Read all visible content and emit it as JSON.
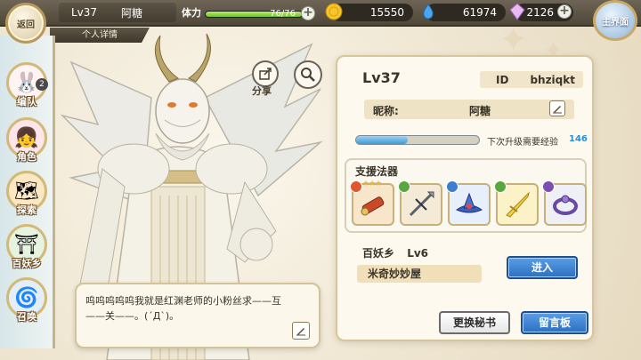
{
  "topbar": {
    "back_label": "返回",
    "player_level": "Lv37",
    "player_name": "阿糖",
    "stamina_label": "体力",
    "stamina_value": "76/76",
    "stamina_fraction": 1.0,
    "gold": "15550",
    "water": "61974",
    "crystal": "2126",
    "main_label": "主界面"
  },
  "tab": {
    "label": "个人详情"
  },
  "nav": {
    "items": [
      {
        "label": "编队",
        "icon": "team-icon",
        "badge": "2"
      },
      {
        "label": "角色",
        "icon": "character-icon",
        "badge": ""
      },
      {
        "label": "探索",
        "icon": "explore-icon",
        "badge": ""
      },
      {
        "label": "百妖乡",
        "icon": "village-icon",
        "badge": ""
      },
      {
        "label": "召唤",
        "icon": "summon-icon",
        "badge": ""
      }
    ]
  },
  "share_label": "分享",
  "dialog": {
    "text": "呜呜呜呜呜我就是红渊老师的小粉丝求——互——关——。(´Д`)。"
  },
  "profile": {
    "level": "Lv37",
    "id_label": "ID",
    "id_value": "bhziqkt",
    "nickname_label": "昵称:",
    "nickname_value": "阿糖",
    "exp_label": "下次升级需要经验",
    "exp_value": "146",
    "exp_fraction": 0.42,
    "support_title": "支援法器",
    "fabao": [
      {
        "name": "red-scroll-item",
        "element": "fire",
        "color": "#e0562e",
        "stars": 3
      },
      {
        "name": "spear-item",
        "element": "wind",
        "color": "#5aa640",
        "stars": 0
      },
      {
        "name": "blue-hat-item",
        "element": "water",
        "color": "#3b7fd0",
        "stars": 0
      },
      {
        "name": "yellow-sword-item",
        "element": "wind",
        "color": "#5aa640",
        "stars": 0
      },
      {
        "name": "purple-ring-item",
        "element": "dark",
        "color": "#7a4fb0",
        "stars": 0
      }
    ],
    "village_label": "百妖乡",
    "village_level": "Lv6",
    "shop_name": "米奇妙妙屋",
    "enter_label": "进入",
    "change_secretary_label": "更换秘书",
    "message_board_label": "留言板"
  },
  "colors": {
    "accent_blue": "#2d6fc1",
    "stamina_green": "#6fbf2e",
    "exp_blue": "#3c9ad8",
    "frame_gold": "#d3b978"
  }
}
